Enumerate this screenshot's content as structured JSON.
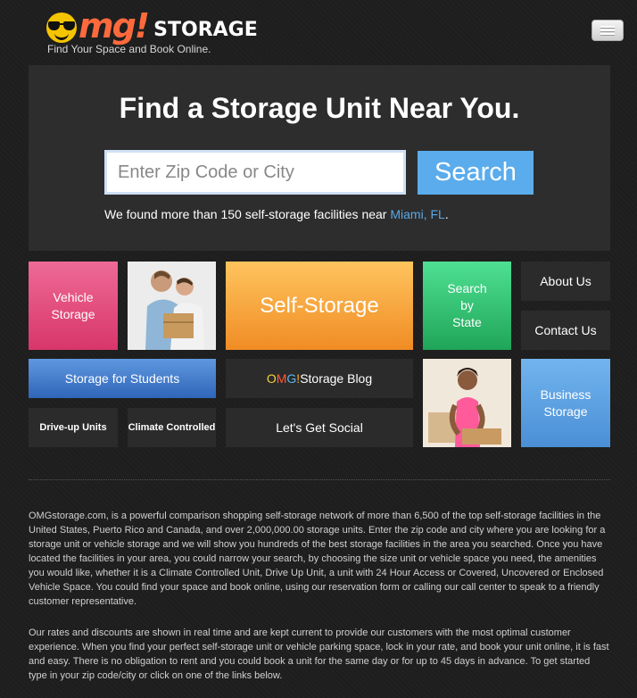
{
  "header": {
    "logo_mg": "mg!",
    "logo_storage": "STORAGE",
    "tagline": "Find Your Space and Book Online."
  },
  "hero": {
    "title": "Find a Storage Unit Near You.",
    "search_placeholder": "Enter Zip Code or City",
    "search_value": "",
    "search_button": "Search",
    "found_prefix": "We found more than 150 self-storage facilities near ",
    "found_location": "Miami, FL",
    "found_suffix": "."
  },
  "tiles": {
    "vehicle_line1": "Vehicle",
    "vehicle_line2": "Storage",
    "self_storage": "Self-Storage",
    "state_line1": "Search",
    "state_line2": "by",
    "state_line3": "State",
    "about": "About Us",
    "contact": "Contact Us",
    "students": "Storage for Students",
    "blog_o": "O",
    "blog_m": "M",
    "blog_g": "G",
    "blog_x": "!",
    "blog_rest": " Storage Blog",
    "business_line1": "Business",
    "business_line2": "Storage",
    "driveup": "Drive-up Units",
    "climate": "Climate Controlled",
    "social": "Let's Get Social"
  },
  "content": {
    "paragraph1": "OMGstorage.com, is a powerful comparison shopping self-storage network of more than 6,500 of the top self-storage facilities in the United States, Puerto Rico and Canada, and over 2,000,000.00 storage units. Enter the zip code and city where you are looking for a storage unit or vehicle storage and we will show you hundreds of the best storage facilities in the area you searched. Once you have located the facilities in your area, you could narrow your search, by choosing the size unit or vehicle space you need, the amenities you would like, whether it is a Climate Controlled Unit, Drive Up Unit, a unit with 24 Hour Access or Covered, Uncovered or Enclosed Vehicle Space. You could find your space and book online, using our reservation form or calling our call center to speak to a friendly customer representative.",
    "paragraph2": "Our rates and discounts are shown in real time and are kept current to provide our customers with the most optimal customer experience. When you find your perfect self-storage unit or vehicle parking space, lock in your rate, and book your unit online, it is fast and easy. There is no obligation to rent and you could book a unit for the same day or for up to 45 days in advance. To get started type in your zip code/city or click on one of the links below."
  },
  "colors": {
    "background": "#1e1e1e",
    "hero_panel": "#2d2d2d",
    "search_button": "#5aacec",
    "link": "#5aa8e6",
    "vehicle": "#e04f7e",
    "self_storage": "#f5a23a",
    "state": "#34c374",
    "students": "#4a82d0",
    "business": "#5fa3e4",
    "dark_tile": "#2b2b2b"
  },
  "icons": {
    "logo": "sunglasses-smiley-icon",
    "menu": "hamburger-menu-icon"
  }
}
